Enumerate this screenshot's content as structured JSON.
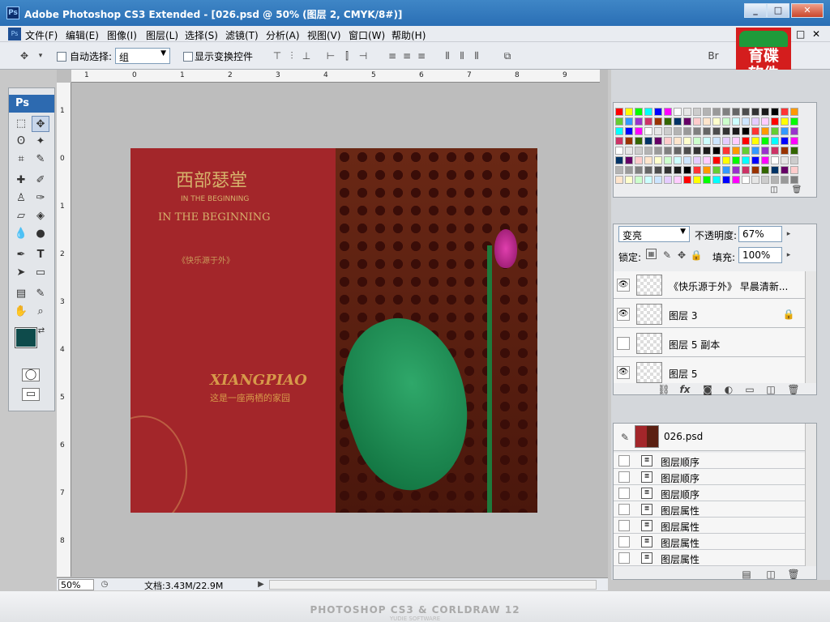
{
  "titlebar": {
    "app_icon": "Ps",
    "title": "Adobe Photoshop CS3 Extended - [026.psd @ 50% (图层 2, CMYK/8#)]",
    "buttons": [
      "_",
      "□",
      "✕"
    ]
  },
  "menubar": {
    "items": [
      "文件(F)",
      "编辑(E)",
      "图像(I)",
      "图层(L)",
      "选择(S)",
      "滤镜(T)",
      "分析(A)",
      "视图(V)",
      "窗口(W)",
      "帮助(H)"
    ],
    "doc_buttons": [
      "□",
      "✕"
    ]
  },
  "options": {
    "auto_select_label": "自动选择:",
    "auto_select_value": "组",
    "show_transform_label": "显示变换控件"
  },
  "logo": {
    "line1": "育碟",
    "line2": "软件"
  },
  "toolbox": {
    "header": "Ps"
  },
  "ruler_h": [
    "1",
    "0",
    "1",
    "2",
    "3",
    "4",
    "5",
    "6",
    "7",
    "8",
    "9"
  ],
  "ruler_v": [
    "1",
    "0",
    "1",
    "2",
    "3",
    "4",
    "5",
    "6",
    "7",
    "8"
  ],
  "document": {
    "text1": "西部瑟堂",
    "text2": "IN THE BEGINNING",
    "text3": "IN THE BEGINNING",
    "text4": "《快乐源于外》",
    "text5": "XIANGPIAO",
    "text6": "这是一座两栖的家园"
  },
  "status": {
    "zoom": "50%",
    "doc_info": "文档:3.43M/22.9M"
  },
  "layers": {
    "blend_mode": "变亮",
    "opacity_label": "不透明度:",
    "opacity": "67%",
    "lock_label": "锁定:",
    "fill_label": "填充:",
    "fill": "100%",
    "rows": [
      {
        "name": "《快乐源于外》 早晨清新...",
        "visible": true
      },
      {
        "name": "图层 3",
        "visible": true
      },
      {
        "name": "图层 5 副本",
        "visible": false
      },
      {
        "name": "图层 5",
        "visible": true
      }
    ]
  },
  "history": {
    "snapshot": "026.psd",
    "rows": [
      "图层顺序",
      "图层顺序",
      "图层顺序",
      "图层属性",
      "图层属性",
      "图层属性",
      "图层属性"
    ]
  },
  "bottom": {
    "banner": "PHOTOSHOP CS3 & CORLDRAW 12",
    "sub": "YUDIE SOFTWARE"
  },
  "swatch_colors": [
    "#ff0000",
    "#ffff00",
    "#00ff00",
    "#00ffff",
    "#0000ff",
    "#ff00ff",
    "#ffffff",
    "#e6e6e6",
    "#cccccc",
    "#b3b3b3",
    "#999999",
    "#808080",
    "#666666",
    "#4d4d4d",
    "#333333",
    "#1a1a1a",
    "#000000",
    "#ff3333",
    "#ff9900",
    "#66cc33",
    "#3399ff",
    "#9933cc",
    "#cc3366",
    "#993300",
    "#336600",
    "#003366",
    "#660066",
    "#ffcccc",
    "#ffe5cc",
    "#ffffcc",
    "#ccffcc",
    "#ccffff",
    "#cce5ff",
    "#e5ccff",
    "#ffccff"
  ]
}
